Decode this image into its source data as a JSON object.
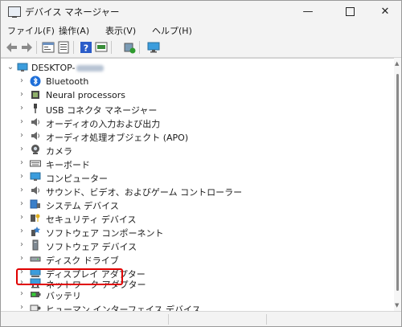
{
  "window": {
    "title": "デバイス マネージャー",
    "minimize": "—",
    "maximize": "",
    "close": "✕"
  },
  "menu": {
    "file": "ファイル(F)",
    "action": "操作(A)",
    "view": "表示(V)",
    "help": "ヘルプ(H)"
  },
  "toolbar": [
    "back-icon",
    "forward-icon",
    "properties-icon",
    "device-list-icon",
    "help-icon",
    "update-driver-icon",
    "add-legacy-hardware-icon",
    "scan-hardware-changes-icon"
  ],
  "tree": {
    "root": "DESKTOP-",
    "items": [
      {
        "label": "Bluetooth",
        "icon": "bluetooth-icon"
      },
      {
        "label": "Neural processors",
        "icon": "neural-processor-icon"
      },
      {
        "label": "USB コネクタ マネージャー",
        "icon": "usb-connector-icon"
      },
      {
        "label": "オーディオの入力および出力",
        "icon": "speaker-icon"
      },
      {
        "label": "オーディオ処理オブジェクト (APO)",
        "icon": "speaker-icon"
      },
      {
        "label": "カメラ",
        "icon": "camera-icon"
      },
      {
        "label": "キーボード",
        "icon": "keyboard-icon"
      },
      {
        "label": "コンピューター",
        "icon": "computer-icon"
      },
      {
        "label": "サウンド、ビデオ、およびゲーム コントローラー",
        "icon": "sound-video-icon"
      },
      {
        "label": "システム デバイス",
        "icon": "system-device-icon"
      },
      {
        "label": "セキュリティ デバイス",
        "icon": "security-device-icon"
      },
      {
        "label": "ソフトウェア コンポーネント",
        "icon": "software-component-icon"
      },
      {
        "label": "ソフトウェア デバイス",
        "icon": "software-device-icon"
      },
      {
        "label": "ディスク ドライブ",
        "icon": "disk-drive-icon"
      },
      {
        "label": "ディスプレイ アダプター",
        "icon": "display-adapter-icon"
      },
      {
        "label": "ネットワーク アダプター",
        "icon": "network-adapter-icon"
      },
      {
        "label": "バッテリ",
        "icon": "battery-icon"
      },
      {
        "label": "ヒューマン インターフェイス デバイス",
        "icon": "hid-icon"
      }
    ]
  },
  "colors": {
    "highlight_box": "#e00000",
    "bluetooth": "#1e6fd9",
    "monitor": "#3b9ddd"
  }
}
